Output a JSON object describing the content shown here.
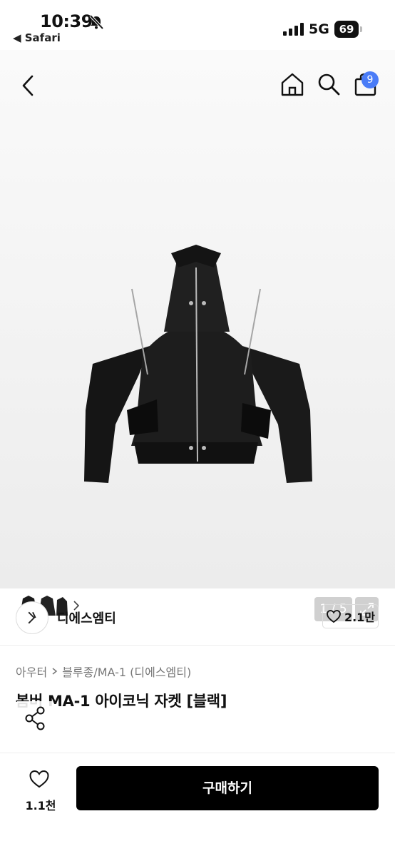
{
  "status_bar": {
    "time": "10:39",
    "back_app": "◀ Safari",
    "network": "5G",
    "battery": "69"
  },
  "header": {
    "cart_count": "9"
  },
  "gallery": {
    "pager": "1 / 5"
  },
  "brand": {
    "name": "디에스엠티",
    "likes": "2.1만"
  },
  "product": {
    "breadcrumb": [
      "아우터",
      "블루종/MA-1 (디에스엠티)"
    ],
    "title": "봄버 MA-1 아이코닉 자켓 [블랙]"
  },
  "bottom": {
    "wish_count": "1.1천",
    "buy_label": "구매하기"
  },
  "colors": {
    "badge": "#4a7cf7",
    "buy_button": "#000000"
  }
}
